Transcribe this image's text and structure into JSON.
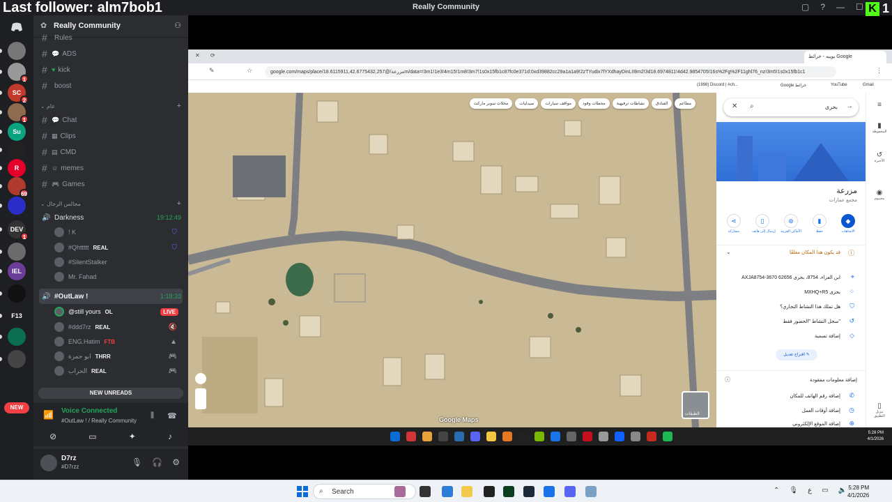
{
  "stream_overlay": {
    "follower_text": "Last follower: alm7bob1",
    "badge_letter": "K",
    "badge_count": "1"
  },
  "discord": {
    "window_title": "Really Community",
    "server_name": "Really Community",
    "channels_top": [
      {
        "label": "Rules"
      },
      {
        "label": "ADS"
      },
      {
        "label": "kick"
      },
      {
        "label": "boost"
      }
    ],
    "category_general": "عام",
    "channels_general": [
      {
        "label": "Chat"
      },
      {
        "label": "Clips"
      },
      {
        "label": "CMD"
      },
      {
        "label": "memes"
      },
      {
        "label": "Games"
      }
    ],
    "category_voice": "مجالس الرجال",
    "voice_channels": [
      {
        "name": "Darkness",
        "time": "19:12:49",
        "users": [
          {
            "name": "! K",
            "tag": ""
          },
          {
            "name": "#Qhttttt",
            "tag": "REAL"
          },
          {
            "name": "#SilentStalker",
            "tag": ""
          },
          {
            "name": "Mr. Fahad",
            "tag": ""
          }
        ]
      },
      {
        "name": "#OutLaw !",
        "time": "1:18:33",
        "users": [
          {
            "name": "@still yours",
            "tag": "OL",
            "live": "LIVE"
          },
          {
            "name": "#ddd7rz",
            "tag": "REAL"
          },
          {
            "name": "ENG.Hatim",
            "tag": "FTB"
          },
          {
            "name": "ابو حمزة",
            "tag": "THRR"
          },
          {
            "name": "الحراب",
            "tag": "REAL"
          }
        ]
      }
    ],
    "new_unreads": "NEW UNREADS",
    "new_pill": "NEW",
    "voice_status": "Voice Connected",
    "voice_channel": "#OutLaw ! / Really Community",
    "user": {
      "name": "D7rz",
      "tag": "#D7rzz"
    },
    "servers": [
      {
        "label": "",
        "badge": "",
        "color": "#5865f2"
      },
      {
        "label": "",
        "badge": "",
        "color": "#777"
      },
      {
        "label": "",
        "badge": "1",
        "color": "#999"
      },
      {
        "label": "SC",
        "badge": "2",
        "color": "#c0392b"
      },
      {
        "label": "",
        "badge": "1",
        "color": "#8e6b4f"
      },
      {
        "label": "Su",
        "badge": "",
        "color": "#0aa37f"
      },
      {
        "label": "",
        "badge": "",
        "color": "#222"
      },
      {
        "label": "R",
        "badge": "",
        "color": "#e4002b"
      },
      {
        "label": "",
        "badge": "69",
        "color": "#b03a2e"
      },
      {
        "label": "",
        "badge": "",
        "color": "#2b2dc9"
      },
      {
        "label": "DEV",
        "badge": "1",
        "color": "#333"
      },
      {
        "label": "",
        "badge": "",
        "color": "#6b6b6b"
      },
      {
        "label": "IEL",
        "badge": "",
        "color": "#6a3d9a"
      },
      {
        "label": "",
        "badge": "",
        "color": "#111"
      },
      {
        "label": "F13",
        "badge": "",
        "color": "#1e1f22"
      },
      {
        "label": "",
        "badge": "",
        "color": "#0b6e4f"
      },
      {
        "label": "",
        "badge": "",
        "color": "#444"
      }
    ]
  },
  "browser": {
    "tab_label": "بويبه - خرائط Google",
    "url": "google.com/maps/place/مزرعة/@18.6115911,42.6775432,257m/data=!3m1!1e3!4m15!1m8!3m7!1s0x15fb1c87fc0e371d:0xd39882cc29a1a1a9!2zTYudix7fYXdhayDinLI!8m2!3d18.6974811!4d42.9854705!16s%2Fg%2F11ghl76_nz!3m5!1s0x15fb1c1",
    "bookmarks": [
      "(1998) Discord | #ch...",
      "Google خرائط",
      "YouTube",
      "Gmail"
    ],
    "map_chips": [
      "مطاعم",
      "الفنادق",
      "نشاطات ترفيهية",
      "محطات وقود",
      "مواقف سيارات",
      "صيدليات",
      "محلات سوبر ماركت"
    ],
    "map_labels": [
      "Google Maps",
      "الطبقات"
    ],
    "search_value": "بحرى",
    "place_name": "مزرعة",
    "place_category": "مجمع عمارات",
    "actions": [
      {
        "label": "الاتجاهات",
        "icon": "directions-icon"
      },
      {
        "label": "حفظ",
        "icon": "bookmark-icon"
      },
      {
        "label": "الأماكن القريبة",
        "icon": "nearby-icon"
      },
      {
        "label": "إرسال إلى هاتف",
        "icon": "send-icon"
      },
      {
        "label": "مشاركة",
        "icon": "share-icon"
      }
    ],
    "notice": "قد يكون هذا المكان مغلقًا",
    "info_rows": [
      {
        "text": "AXJA8754-3670 ابن العزاء، 8754، بحرى 62656",
        "icon": "pin-icon"
      },
      {
        "text": "MXHQ+R5 بحرى",
        "icon": "plus-code-icon"
      },
      {
        "text": "هل تملك هذا النشاط التجاري؟",
        "icon": "shield-icon"
      },
      {
        "text": "سجل النشاط \"الحضور فقط\"",
        "icon": "history-icon"
      },
      {
        "text": "إضافة تسمية",
        "icon": "label-icon"
      }
    ],
    "suggest_button": "اقتراح تعديل",
    "missing_info": "إضافة معلومات مفقودة",
    "extra_rows": [
      "إضافة رقم الهاتف للمكان",
      "إضافة أوقات العمل",
      "إضافة الموقع الإلكتروني"
    ],
    "right_rail": [
      {
        "label": "المحفوظة",
        "icon": "bookmark-icon"
      },
      {
        "label": "الأخيرة",
        "icon": "history-icon"
      },
      {
        "label": "محيبوم",
        "icon": "avatar-icon"
      },
      {
        "label": "تنزيل التطبيق",
        "icon": "phone-icon"
      }
    ],
    "inner_clock_time": "5:28 PM",
    "inner_clock_date": "4/1/2026"
  },
  "taskbar": {
    "search_placeholder": "Search",
    "time": "5:28 PM",
    "date": "4/1/2026"
  }
}
